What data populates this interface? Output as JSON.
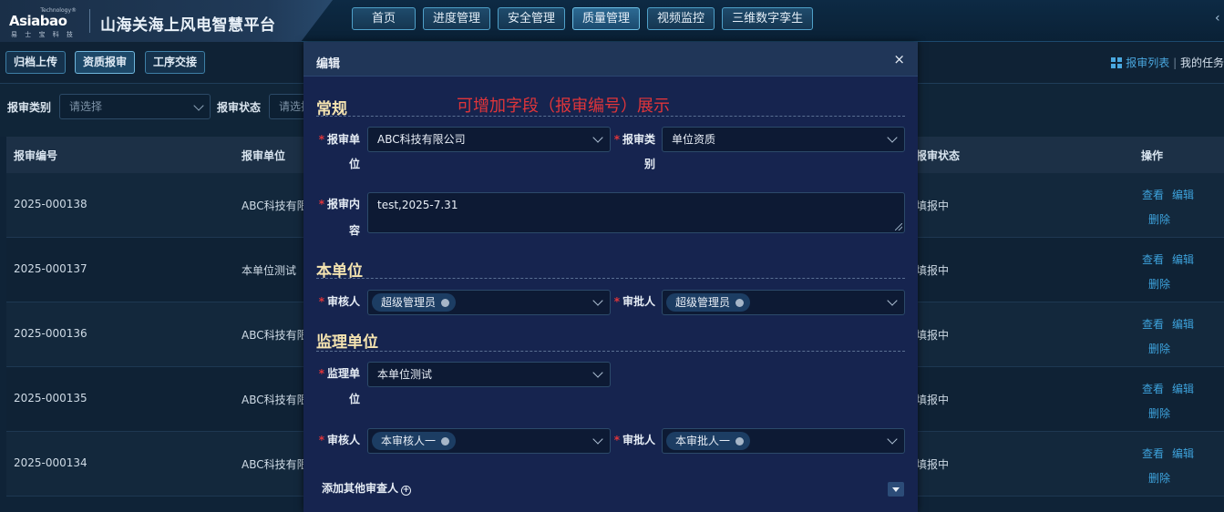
{
  "header": {
    "logo_text": "Asiabao",
    "logo_small": "Technology®",
    "logo_sub": "易 士 宝 科 技",
    "platform_title": "山海关海上风电智慧平台",
    "nav": [
      "首页",
      "进度管理",
      "安全管理",
      "质量管理",
      "视频监控",
      "三维数字孪生"
    ],
    "active_nav": "质量管理"
  },
  "subbar": {
    "tabs": [
      "归档上传",
      "资质报审",
      "工序交接"
    ],
    "active_tab": "资质报审",
    "right_link": "报审列表",
    "right_text": "我的任务"
  },
  "filters": {
    "category_label": "报审类别",
    "category_placeholder": "请选择",
    "status_label": "报审状态",
    "status_placeholder": "请选择"
  },
  "table": {
    "columns": [
      "报审编号",
      "报审单位",
      "报审状态",
      "操作"
    ],
    "rows": [
      {
        "code": "2025-000138",
        "unit": "ABC科技有限",
        "status": "填报中"
      },
      {
        "code": "2025-000137",
        "unit": "本单位测试",
        "status": "填报中"
      },
      {
        "code": "2025-000136",
        "unit": "ABC科技有限",
        "status": "填报中"
      },
      {
        "code": "2025-000135",
        "unit": "ABC科技有限",
        "status": "填报中"
      },
      {
        "code": "2025-000134",
        "unit": "ABC科技有限",
        "status": "填报中"
      }
    ],
    "actions": {
      "view": "查看",
      "edit": "编辑",
      "delete": "删除"
    }
  },
  "modal": {
    "title": "编辑",
    "close": "×",
    "note": "可增加字段（报审编号）展示",
    "sections": {
      "general": "常规",
      "own_unit": "本单位",
      "supervisor": "监理单位"
    },
    "fields": {
      "unit_label_1": "报审单",
      "unit_label_2": "位",
      "unit_value": "ABC科技有限公司",
      "category_label_1": "报审类",
      "category_label_2": "别",
      "category_value": "单位资质",
      "content_label_1": "报审内",
      "content_label_2": "容",
      "content_value": "test,2025-7.31",
      "reviewer_label": "审核人",
      "reviewer_value": "超级管理员",
      "approver_label": "审批人",
      "approver_value": "超级管理员",
      "supervisor_label_1": "监理单",
      "supervisor_label_2": "位",
      "supervisor_value": "本单位测试",
      "sup_reviewer_label": "审核人",
      "sup_reviewer_value": "本审核人一",
      "sup_approver_label": "审批人",
      "sup_approver_value": "本审批人一"
    },
    "add_more": "添加其他审查人"
  },
  "colors": {
    "accent": "#3ea3dd",
    "required": "#e0353a",
    "section_title": "#f4e3b0"
  }
}
